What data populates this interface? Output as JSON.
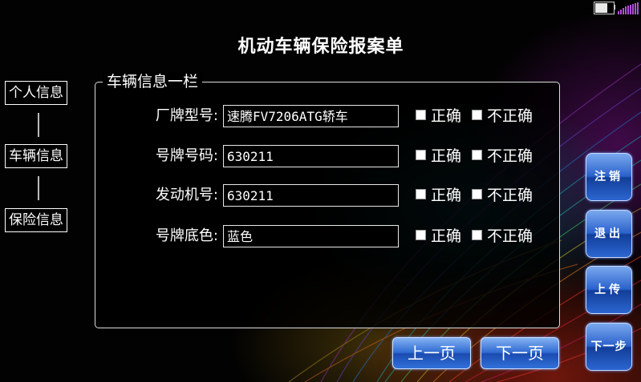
{
  "header": {
    "title": "机动车辆保险报案单"
  },
  "status_bar": {
    "battery_level": 0.7,
    "battery_icon": "battery-icon",
    "signal_icon": "signal-icon",
    "signal_color": "#b050d8"
  },
  "steps": [
    {
      "label": "个人信息"
    },
    {
      "label": "车辆信息"
    },
    {
      "label": "保险信息"
    }
  ],
  "panel": {
    "legend": "车辆信息一栏",
    "rows": [
      {
        "label": "厂牌型号:",
        "value": "速腾FV7206ATG轿车",
        "correct": "正确",
        "incorrect": "不正确"
      },
      {
        "label": "号牌号码:",
        "value": "630211",
        "correct": "正确",
        "incorrect": "不正确"
      },
      {
        "label": "发动机号:",
        "value": "630211",
        "correct": "正确",
        "incorrect": "不正确"
      },
      {
        "label": "号牌底色:",
        "value": "蓝色",
        "correct": "正确",
        "incorrect": "不正确"
      }
    ]
  },
  "side_buttons": [
    {
      "label": "注销"
    },
    {
      "label": "退出"
    },
    {
      "label": "上传"
    },
    {
      "label": "下一步"
    }
  ],
  "nav": {
    "prev_label": "上一页",
    "next_label": "下一页"
  },
  "colors": {
    "button_blue": "#2a62cc",
    "text": "#ffffff",
    "background": "#000000"
  }
}
